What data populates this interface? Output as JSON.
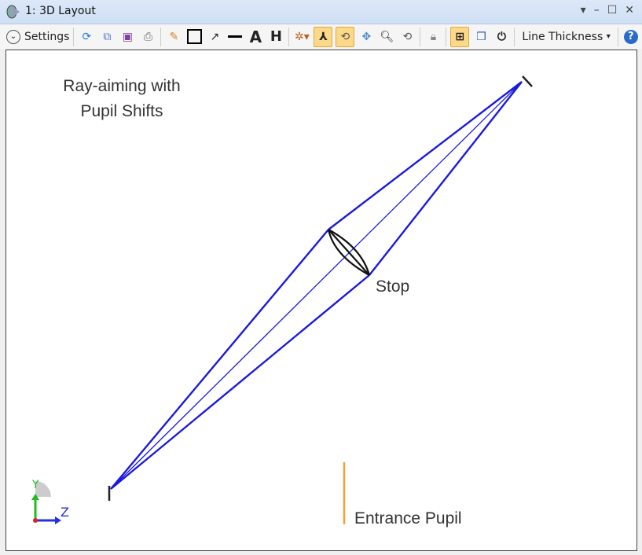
{
  "window": {
    "title": "1: 3D Layout"
  },
  "toolbar": {
    "settings_label": "Settings",
    "line_thickness_label": "Line Thickness"
  },
  "plot": {
    "annotation_line1": "Ray-aiming with",
    "annotation_line2": "Pupil Shifts",
    "stop_label": "Stop",
    "entrance_pupil_label": "Entrance Pupil",
    "axis_y": "Y",
    "axis_z": "Z"
  },
  "colors": {
    "rays": "#1a1adf",
    "pupil": "#f5a030",
    "lens": "#111111"
  }
}
